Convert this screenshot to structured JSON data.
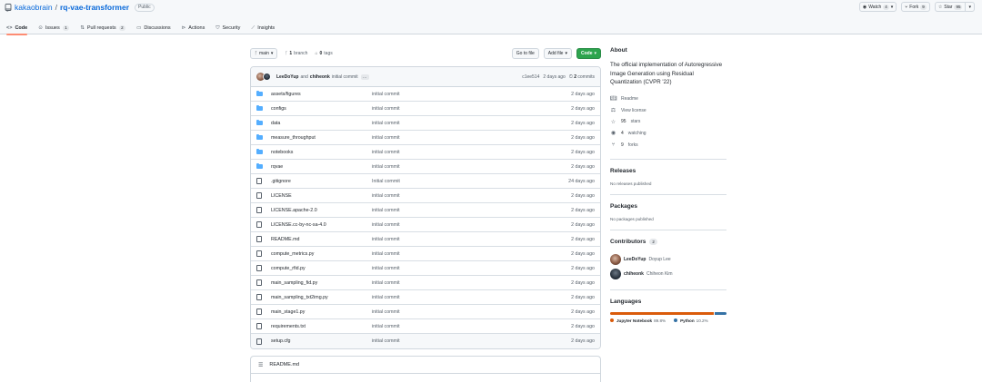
{
  "repo": {
    "owner": "kakaobrain",
    "separator": "/",
    "name": "rq-vae-transformer",
    "visibility": "Public"
  },
  "header_actions": {
    "watch": {
      "label": "Watch",
      "count": "4"
    },
    "fork": {
      "label": "Fork",
      "count": "9"
    },
    "star": {
      "label": "Star",
      "count": "95"
    }
  },
  "tabs": [
    {
      "label": "Code",
      "count": null,
      "icon": "code-icon",
      "active": true
    },
    {
      "label": "Issues",
      "count": "1",
      "icon": "issue-icon"
    },
    {
      "label": "Pull requests",
      "count": "2",
      "icon": "pull-request-icon"
    },
    {
      "label": "Discussions",
      "count": null,
      "icon": "discussion-icon"
    },
    {
      "label": "Actions",
      "count": null,
      "icon": "actions-icon"
    },
    {
      "label": "Security",
      "count": null,
      "icon": "shield-icon"
    },
    {
      "label": "Insights",
      "count": null,
      "icon": "graph-icon"
    }
  ],
  "branch_bar": {
    "branch": "main",
    "branches_count": "1",
    "branches_label": "branch",
    "tags_count": "0",
    "tags_label": "tags",
    "goto_file": "Go to file",
    "add_file": "Add file",
    "code": "Code"
  },
  "commit": {
    "author1": "LeeDoYup",
    "and": "and",
    "author2": "chiheonk",
    "message": "initial commit",
    "ellipsis": "…",
    "hash": "c1ee514",
    "age": "2 days ago",
    "commits_count": "2",
    "commits_label": "commits"
  },
  "files": [
    {
      "name": "assets/figures",
      "type": "dir",
      "message": "initial commit",
      "age": "2 days ago"
    },
    {
      "name": "configs",
      "type": "dir",
      "message": "initial commit",
      "age": "2 days ago"
    },
    {
      "name": "data",
      "type": "dir",
      "message": "initial commit",
      "age": "2 days ago"
    },
    {
      "name": "measure_throughput",
      "type": "dir",
      "message": "initial commit",
      "age": "2 days ago"
    },
    {
      "name": "notebooks",
      "type": "dir",
      "message": "initial commit",
      "age": "2 days ago"
    },
    {
      "name": "rqvae",
      "type": "dir",
      "message": "initial commit",
      "age": "2 days ago"
    },
    {
      "name": ".gitignore",
      "type": "file",
      "message": "Initial commit",
      "age": "24 days ago"
    },
    {
      "name": "LICENSE",
      "type": "file",
      "message": "initial commit",
      "age": "2 days ago"
    },
    {
      "name": "LICENSE.apache-2.0",
      "type": "file",
      "message": "initial commit",
      "age": "2 days ago"
    },
    {
      "name": "LICENSE.cc-by-nc-sa-4.0",
      "type": "file",
      "message": "initial commit",
      "age": "2 days ago"
    },
    {
      "name": "README.md",
      "type": "file",
      "message": "initial commit",
      "age": "2 days ago"
    },
    {
      "name": "compute_metrics.py",
      "type": "file",
      "message": "initial commit",
      "age": "2 days ago"
    },
    {
      "name": "compute_rfid.py",
      "type": "file",
      "message": "initial commit",
      "age": "2 days ago"
    },
    {
      "name": "main_sampling_fid.py",
      "type": "file",
      "message": "initial commit",
      "age": "2 days ago"
    },
    {
      "name": "main_sampling_txt2img.py",
      "type": "file",
      "message": "initial commit",
      "age": "2 days ago"
    },
    {
      "name": "main_stage1.py",
      "type": "file",
      "message": "initial commit",
      "age": "2 days ago"
    },
    {
      "name": "requirements.txt",
      "type": "file",
      "message": "initial commit",
      "age": "2 days ago"
    },
    {
      "name": "setup.cfg",
      "type": "file",
      "message": "initial commit",
      "age": "2 days ago"
    }
  ],
  "readme": {
    "title": "README.md"
  },
  "about": {
    "title": "About",
    "description": "The official implementation of Autoregressive Image Generation using Residual Quantization (CVPR '22)",
    "readme": "Readme",
    "license": "View license",
    "stars_count": "95",
    "stars_label": "stars",
    "watching_count": "4",
    "watching_label": "watching",
    "forks_count": "9",
    "forks_label": "forks"
  },
  "releases": {
    "title": "Releases",
    "note": "No releases published"
  },
  "packages": {
    "title": "Packages",
    "note": "No packages published"
  },
  "contributors": {
    "title": "Contributors",
    "count": "2",
    "people": [
      {
        "login": "LeeDoYup",
        "name": "Doyup Lee"
      },
      {
        "login": "chiheonk",
        "name": "Chiheon Kim"
      }
    ]
  },
  "languages": {
    "title": "Languages",
    "items": [
      {
        "name": "Jupyter Notebook",
        "percent": "89.8%",
        "value": 89.8,
        "color": "#DA5B0B"
      },
      {
        "name": "Python",
        "percent": "10.2%",
        "value": 10.2,
        "color": "#3572A5"
      }
    ]
  },
  "colors": {
    "accent": "#0969da",
    "green": "#2da44e",
    "tab_underline": "#fd8c73",
    "folder": "#54aeff"
  }
}
